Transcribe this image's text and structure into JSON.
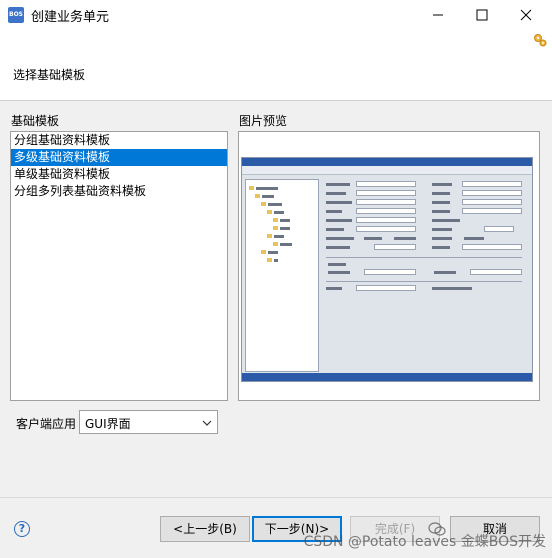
{
  "window": {
    "logo_text": "BOS",
    "title": "创建业务单元"
  },
  "banner": {
    "description": "选择基础模板"
  },
  "templates": {
    "label": "基础模板",
    "items": [
      {
        "label": "分组基础资料模板",
        "selected": false
      },
      {
        "label": "多级基础资料模板",
        "selected": true
      },
      {
        "label": "单级基础资料模板",
        "selected": false
      },
      {
        "label": "分组多列表基础资料模板",
        "selected": false
      }
    ]
  },
  "preview": {
    "label": "图片预览"
  },
  "client": {
    "label": "客户端应用",
    "value": "GUI界面"
  },
  "buttons": {
    "help": "?",
    "back": "<上一步(B)",
    "next": "下一步(N)>",
    "finish": "完成(F)",
    "cancel": "取消"
  },
  "watermark": "CSDN @Potato leaves  金蝶BOS开发"
}
